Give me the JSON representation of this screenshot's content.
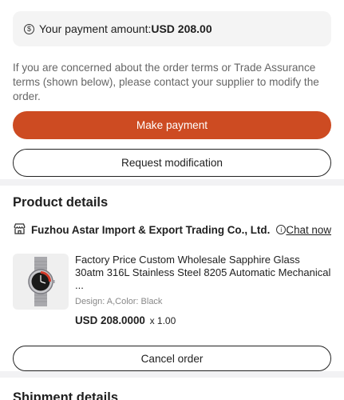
{
  "payment": {
    "label": "Your payment amount:",
    "amount": "USD 208.00",
    "notice": "If you are concerned about the order terms or Trade Assurance terms (shown below), please contact your supplier to modify the order.",
    "make_payment_label": "Make payment",
    "request_modification_label": "Request modification"
  },
  "product": {
    "section_title": "Product details",
    "supplier_name": "Fuzhou Astar Import & Export Trading Co., Ltd.",
    "chat_label": "Chat now",
    "item": {
      "title": "Factory Price Custom Wholesale Sapphire Glass 30atm 316L Stainless Steel 8205 Automatic Mechanical ...",
      "meta": "Design: A,Color: Black",
      "price": "USD 208.0000",
      "quantity": "x 1.00"
    },
    "cancel_label": "Cancel order"
  },
  "shipment": {
    "section_title": "Shipment details"
  },
  "colors": {
    "accent": "#cd4b22"
  }
}
